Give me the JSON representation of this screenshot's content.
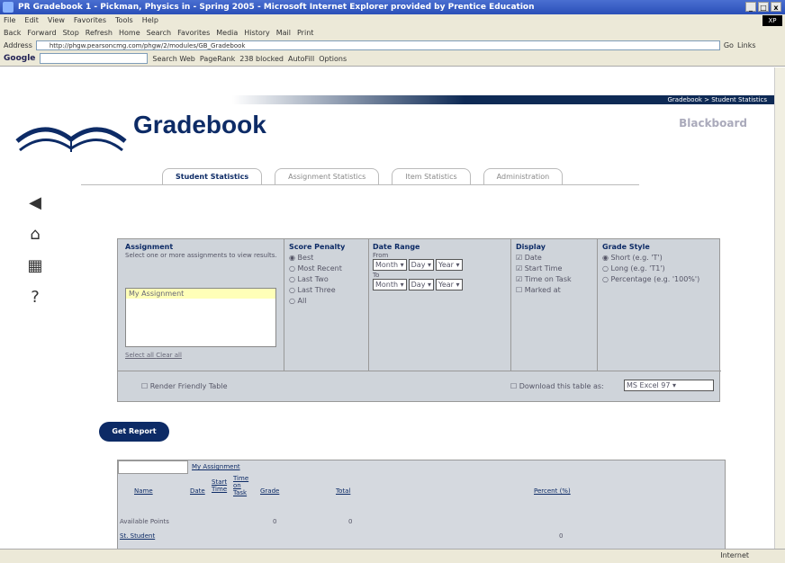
{
  "window": {
    "title": "PR Gradebook 1 - Pickman, Physics in - Spring 2005 - Microsoft Internet Explorer provided by Prentice Education"
  },
  "menu": [
    "File",
    "Edit",
    "View",
    "Favorites",
    "Tools",
    "Help"
  ],
  "toolbar": [
    "Back",
    "Forward",
    "Stop",
    "Refresh",
    "Home",
    "Search",
    "Favorites",
    "Media",
    "History",
    "Mail",
    "Print"
  ],
  "address": {
    "label": "Address",
    "url": "http://phgw.pearsoncmg.com/phgw/2/modules/GB_Gradebook",
    "go": "Go",
    "links": "Links"
  },
  "google": {
    "label": "Google",
    "search_web": "Search Web",
    "pagerank": "PageRank",
    "blocked": "238 blocked",
    "autofill": "AutoFill",
    "options": "Options"
  },
  "header": {
    "breadcrumb": "Gradebook > Student Statistics",
    "title": "Gradebook",
    "brand": "Blackboard"
  },
  "tabs": [
    "Student Statistics",
    "Assignment Statistics",
    "Item Statistics",
    "Administration"
  ],
  "side_icons": [
    "back-arrow-icon",
    "home-icon",
    "list-icon",
    "help-icon"
  ],
  "side_glyphs": [
    "◀",
    "⌂",
    "▦",
    "?"
  ],
  "form": {
    "assignment": {
      "title": "Assignment",
      "desc": "Select one or more assignments to view results.",
      "selected": "My Assignment",
      "select_all": "Select all",
      "clear_all": "Clear all"
    },
    "score_penalty": {
      "title": "Score Penalty",
      "options": [
        "Best",
        "Most Recent",
        "Last Two",
        "Last Three",
        "All"
      ],
      "selected": 0
    },
    "date_range": {
      "title": "Date Range",
      "from": "From",
      "to": "To",
      "month": "Month",
      "day": "Day",
      "year": "Year"
    },
    "display": {
      "title": "Display",
      "options": [
        "Date",
        "Start Time",
        "Time on Task",
        "Marked at"
      ],
      "checked": [
        true,
        true,
        true,
        false
      ]
    },
    "grade_style": {
      "title": "Grade Style",
      "options": [
        "Short (e.g. 'T')",
        "Long (e.g. 'T1')",
        "Percentage (e.g. '100%')"
      ],
      "selected": 0
    },
    "render_friendly": "Render Friendly Table",
    "download_label": "Download this table as:",
    "download_format": "MS Excel 97"
  },
  "get_report": "Get Report",
  "results": {
    "assignment_name": "My Assignment",
    "name_header": "Name",
    "subcols": [
      "Date",
      "Start Time",
      "Time on Task",
      "Grade"
    ],
    "total": "Total",
    "percent": "Percent (%)",
    "available_points_label": "Available Points",
    "available_points": "0",
    "available_total": "0",
    "student_name": "St. Student",
    "student_percent": "0"
  },
  "status": {
    "zone": "Internet"
  }
}
